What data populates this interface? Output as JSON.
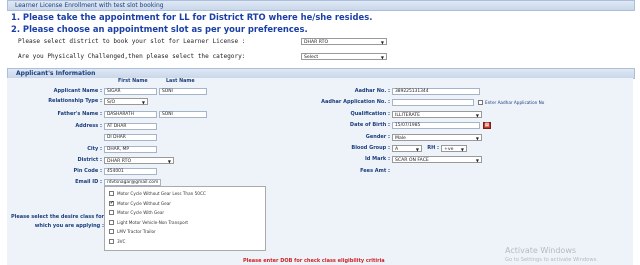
{
  "header": {
    "title": "Learner License Enrollment with test slot booking"
  },
  "instructions": {
    "line1": "1. Please take the appointment for LL for District RTO where he/she resides.",
    "line2": "2. Please choose an appointment slot as per your preferences."
  },
  "district_prompt": {
    "label": "Please select district to book your slot for Learner License :",
    "value": "DHAR RTO"
  },
  "category_prompt": {
    "label": "Are you Physically Challenged,then please select the category:",
    "value": "Select"
  },
  "section_title": "Applicant's Information",
  "columns": {
    "first": "First Name",
    "last": "Last Name"
  },
  "left": {
    "applicant_name": {
      "label": "Applicant Name :",
      "first": "SIGAR",
      "last": "SONI"
    },
    "relationship": {
      "label": "Relationship Type :",
      "value": "S/O"
    },
    "father_name": {
      "label": "Father's Name :",
      "first": "DASHARATH",
      "last": "SONI"
    },
    "address": {
      "label": "Address :",
      "line1": "AT DHAR",
      "line2": "DI DHAR"
    },
    "city": {
      "label": "City :",
      "value": "DHAR, MP"
    },
    "district": {
      "label": "District :",
      "value": "DHAR RTO"
    },
    "pin": {
      "label": "Pin Code :",
      "value": "454001"
    },
    "email": {
      "label": "Email ID :",
      "value": "rdvtsnagar@gmail.com"
    }
  },
  "right": {
    "aadhar_no": {
      "label": "Aadhar No. :",
      "value": "389225131344"
    },
    "aadhar_app": {
      "label": "Aadhar Application No. :",
      "value": "",
      "checkbox_label": "Enter Aadhar Application No"
    },
    "qualification": {
      "label": "Qualification :",
      "value": "ILLITERATE"
    },
    "dob": {
      "label": "Date of Birth :",
      "value": "15/07/1985"
    },
    "gender": {
      "label": "Gender :",
      "value": "Male"
    },
    "blood_group": {
      "label": "Blood Group :",
      "value": "A",
      "rh_label": "RH :",
      "rh_value": "+ve"
    },
    "id_mark": {
      "label": "Id Mark :",
      "value": "SCAR ON FACE"
    },
    "fees": {
      "label": "Fees Amt :",
      "value": ""
    }
  },
  "class_select": {
    "label_line1": "Please select the desire class for",
    "label_line2": "which you are applying :",
    "options": [
      {
        "label": "Motor Cycle Without Gear Less Than 50CC",
        "checked": false
      },
      {
        "label": "Motor Cycle Without Gear",
        "checked": true
      },
      {
        "label": "Motor Cycle With Gear",
        "checked": false
      },
      {
        "label": "Light Motor Vehicle-Non Transport",
        "checked": false
      },
      {
        "label": "LMV Tractor Trailor",
        "checked": false
      },
      {
        "label": "3VC",
        "checked": false
      }
    ]
  },
  "footer_note": "Please enter DOB for check class eligibility critiria",
  "watermark": {
    "line1": "Activate Windows",
    "line2": "Go to Settings to activate Windows."
  }
}
